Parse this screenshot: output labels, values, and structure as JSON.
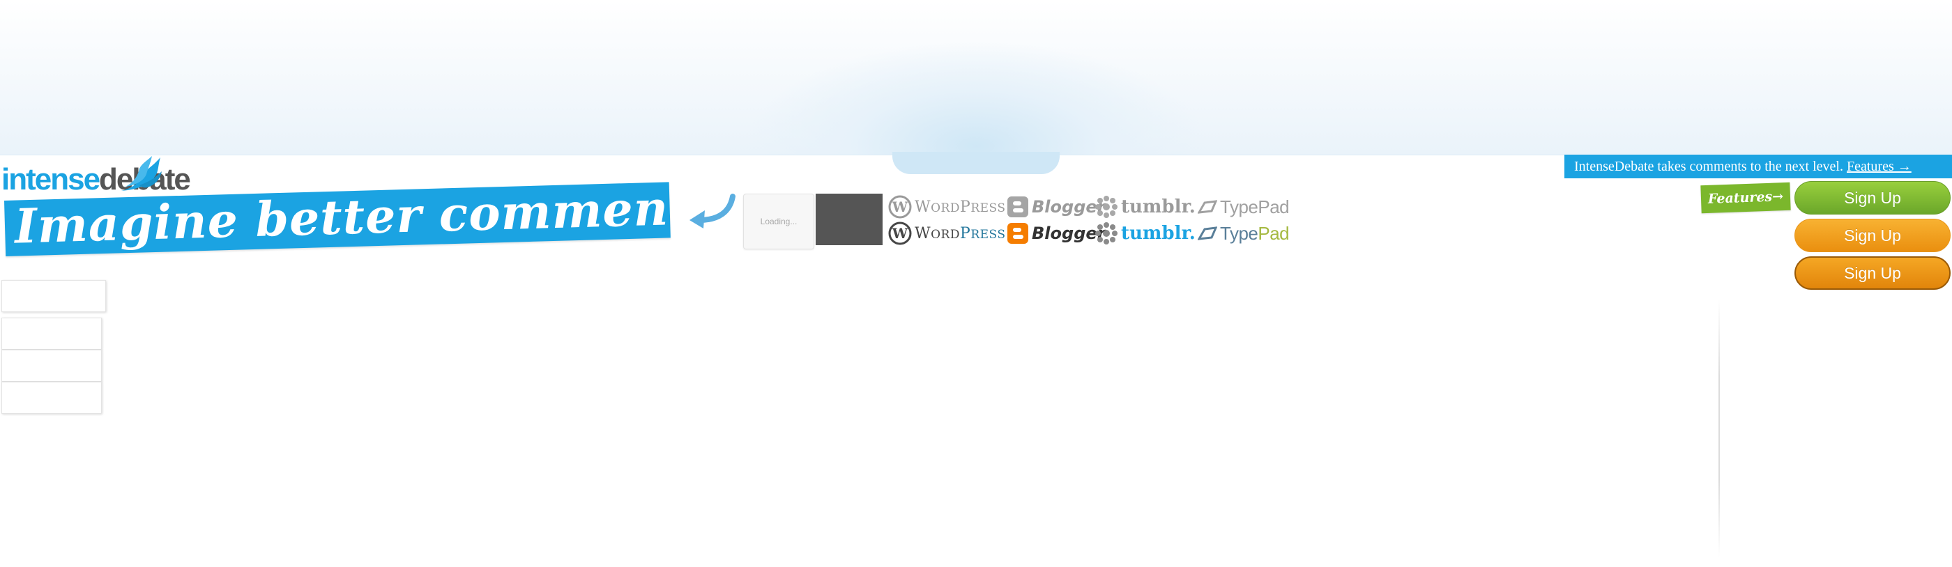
{
  "brand": {
    "logo_intense": "intense",
    "logo_debate": "debate",
    "color_primary": "#1ba3e2",
    "color_dark": "#555555"
  },
  "hero": {
    "tagline": "Imagine better comments."
  },
  "preview": {
    "loading_text": "Loading..."
  },
  "platforms": {
    "faded": [
      {
        "name": "wordpress",
        "label_a": "W",
        "label_b": "ORD",
        "label_c": "P",
        "label_d": "RESS"
      },
      {
        "name": "blogger",
        "label": "Blogger"
      },
      {
        "name": "tumblr",
        "label": "tumblr."
      },
      {
        "name": "typepad",
        "label_a": "Type",
        "label_b": "Pad"
      }
    ],
    "colored": [
      {
        "name": "wordpress",
        "label_a": "W",
        "label_b": "ORD",
        "label_c": "P",
        "label_d": "RESS"
      },
      {
        "name": "blogger",
        "label": "Blogger"
      },
      {
        "name": "tumblr",
        "label": "tumblr."
      },
      {
        "name": "typepad",
        "label_a": "Type",
        "label_b": "Pad"
      }
    ]
  },
  "ticker": {
    "text": "IntenseDebate takes comments to the next level.",
    "link": "Features →"
  },
  "features_tag": "Features→",
  "signup": {
    "green": "Sign Up",
    "orange": "Sign Up",
    "orange_pressed": "Sign Up",
    "colors": {
      "green": "#7fbf30",
      "orange": "#f29e1f"
    }
  }
}
